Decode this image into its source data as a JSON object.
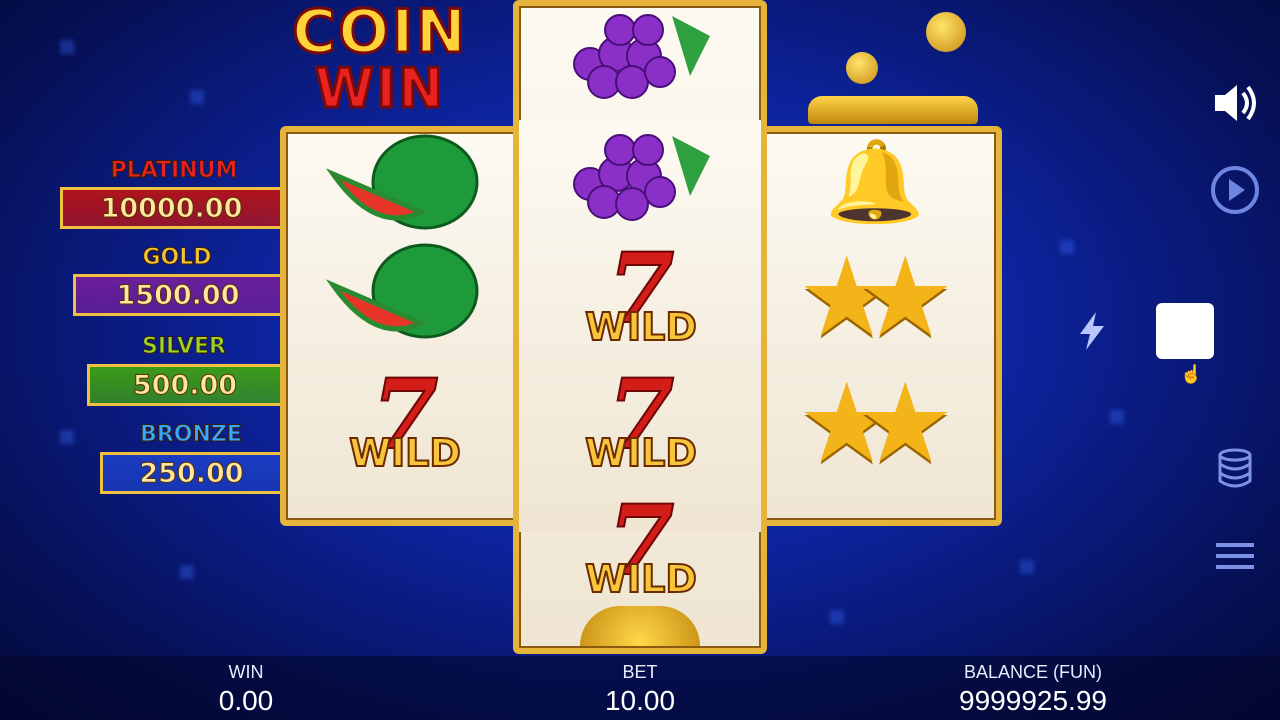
{
  "logo": {
    "line1": "COIN",
    "line2": "WIN"
  },
  "jackpots": [
    {
      "label": "PLATINUM",
      "value": "10000.00",
      "label_color": "#e8231f",
      "box_color": "#b0141c"
    },
    {
      "label": "GOLD",
      "value": "1500.00",
      "label_color": "#f4c430",
      "box_color": "#6b1f9a"
    },
    {
      "label": "SILVER",
      "value": "500.00",
      "label_color": "#9ad62a",
      "box_color": "#3b9a18"
    },
    {
      "label": "BRONZE",
      "value": "250.00",
      "label_color": "#38a8ff",
      "box_color": "#1a3cc0"
    }
  ],
  "reels": {
    "symbols": [
      "watermelon",
      "grapes",
      "wild",
      "stars",
      "bell",
      "coin"
    ],
    "wild_label": "WILD",
    "seven_glyph": "7"
  },
  "controls": {
    "sound_icon": "speaker-icon",
    "autoplay_icon": "autoplay-icon",
    "turbo_icon": "lightning-icon",
    "bet_icon": "coin-stack-icon",
    "menu_icon": "menu-icon"
  },
  "status": {
    "win_label": "WIN",
    "win_value": "0.00",
    "bet_label": "BET",
    "bet_value": "10.00",
    "balance_label": "BALANCE (FUN)",
    "balance_value": "9999925.99"
  },
  "colors": {
    "accent_gold": "#e6b43a",
    "background": "#0d24a0"
  }
}
